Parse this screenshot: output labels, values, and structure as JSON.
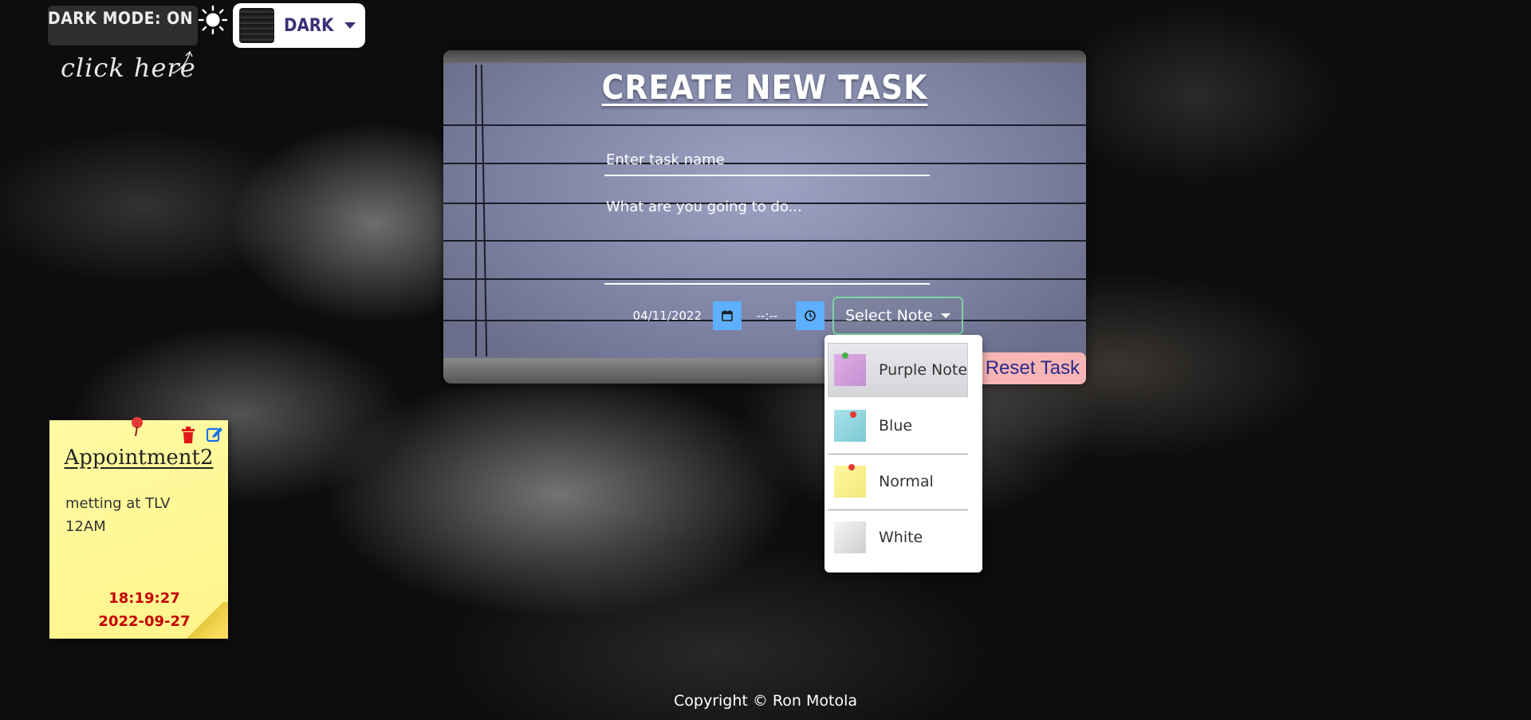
{
  "mode_toggle": {
    "label": "DARK MODE: ON",
    "theme_name": "DARK",
    "hint": "click here"
  },
  "form": {
    "title": "CREATE NEW TASK",
    "name_placeholder": "Enter task name",
    "description_placeholder": "What are you going to do...",
    "date_value": "04/11/2022",
    "time_value": "--:--",
    "note_select_label": "Select Note",
    "reset_label": "Reset Task"
  },
  "note_options": [
    {
      "label": "Purple Note",
      "swatch": "#d9a6e3",
      "selected": true
    },
    {
      "label": "Blue",
      "swatch": "#96d6e0"
    },
    {
      "label": "Normal",
      "swatch": "#fff59a"
    },
    {
      "label": "White",
      "swatch": "#e8e8e8"
    }
  ],
  "tasks": [
    {
      "title": "Appointment2",
      "description_line1": "metting at TLV",
      "description_line2": "12AM",
      "time": "18:19:27",
      "date": "2022-09-27"
    }
  ],
  "footer": {
    "copyright": "Copyright © Ron Motola"
  },
  "colors": {
    "accent_blue": "#5dafff",
    "reset_bg": "#f7b5b5",
    "theme_text": "#3b3077",
    "note_date_red": "#c60000",
    "sticky_yellow": "#fff48a"
  }
}
